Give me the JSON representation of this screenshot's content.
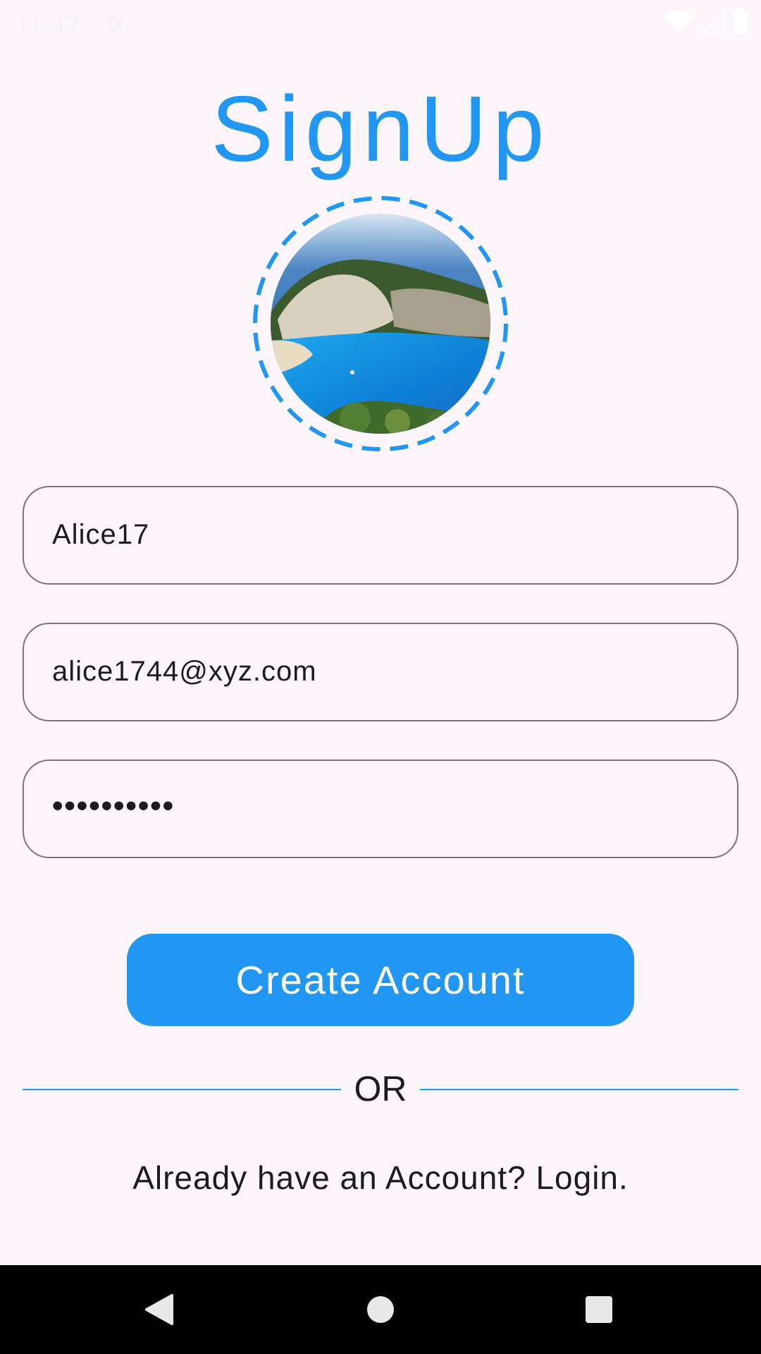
{
  "status_bar": {
    "time": "11:42",
    "icons": [
      "settings-gear-icon",
      "wifi-icon",
      "signal-icon",
      "battery-icon"
    ]
  },
  "header": {
    "title": "SignUp"
  },
  "avatar": {
    "image": "profile-photo-beach-cliff",
    "ring_color": "#2196F3"
  },
  "form": {
    "username_value": "Alice17",
    "email_value": "alice1744@xyz.com",
    "password_value": "••••••••••"
  },
  "actions": {
    "create_account_label": "Create Account",
    "divider_label": "OR",
    "login_prompt": "Already have an Account? Login."
  },
  "nav_bar": {
    "icons": [
      "back-icon",
      "home-icon",
      "recents-icon"
    ]
  },
  "colors": {
    "accent": "#2196F3",
    "background": "#FCF6FB",
    "text": "#1C1B1F",
    "outline": "#7A7579"
  }
}
